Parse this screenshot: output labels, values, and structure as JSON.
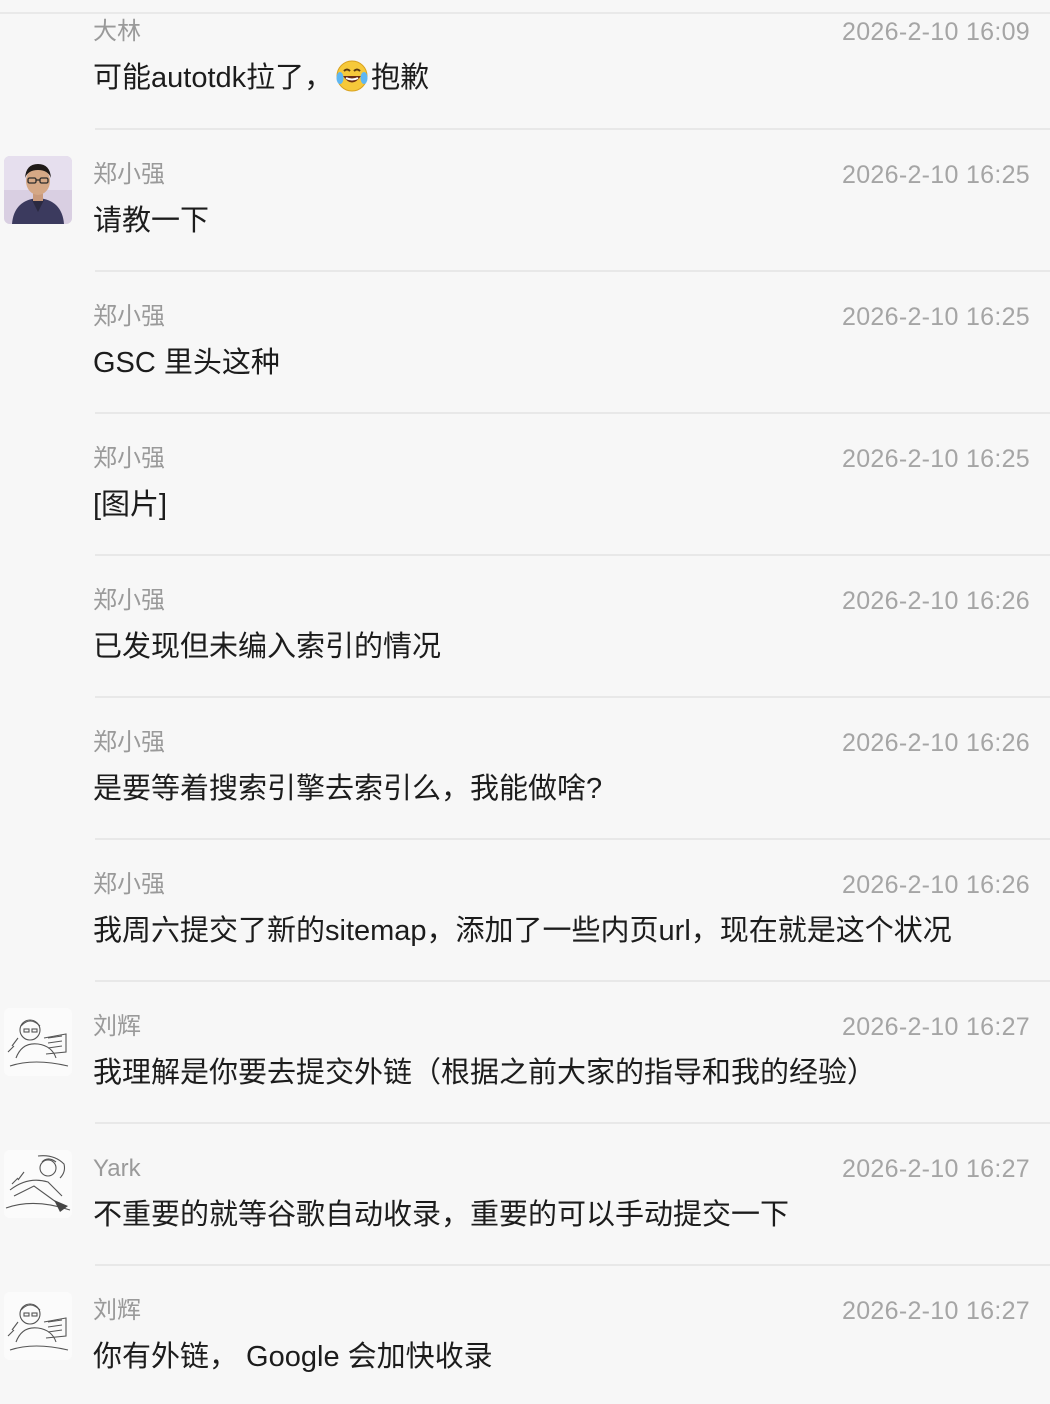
{
  "messages": [
    {
      "sender": "大林",
      "time": "2026-2-10 16:09",
      "text_before": "可能autotdk拉了，",
      "emoji": "face-with-tears-of-joy-icon",
      "text_after": "抱歉",
      "avatar": "none"
    },
    {
      "sender": "郑小强",
      "time": "2026-2-10 16:25",
      "text": "请教一下",
      "avatar": "photo-avatar"
    },
    {
      "sender": "郑小强",
      "time": "2026-2-10 16:25",
      "text": "GSC 里头这种",
      "avatar": "none"
    },
    {
      "sender": "郑小强",
      "time": "2026-2-10 16:25",
      "text": "[图片]",
      "avatar": "none"
    },
    {
      "sender": "郑小强",
      "time": "2026-2-10 16:26",
      "text": "已发现但未编入索引的情况",
      "avatar": "none"
    },
    {
      "sender": "郑小强",
      "time": "2026-2-10 16:26",
      "text": "是要等着搜索引擎去索引么，我能做啥?",
      "avatar": "none"
    },
    {
      "sender": "郑小强",
      "time": "2026-2-10 16:26",
      "text": "我周六提交了新的sitemap，添加了一些内页url，现在就是这个状况",
      "avatar": "none"
    },
    {
      "sender": "刘辉",
      "time": "2026-2-10 16:27",
      "text": "我理解是你要去提交外链（根据之前大家的指导和我的经验）",
      "avatar": "sketch-avatar"
    },
    {
      "sender": "Yark",
      "time": "2026-2-10 16:27",
      "text": "不重要的就等谷歌自动收录，重要的可以手动提交一下",
      "avatar": "sketch-avatar-2"
    },
    {
      "sender": "刘辉",
      "time": "2026-2-10 16:27",
      "text": "你有外链， Google 会加快收录",
      "avatar": "sketch-avatar"
    }
  ]
}
